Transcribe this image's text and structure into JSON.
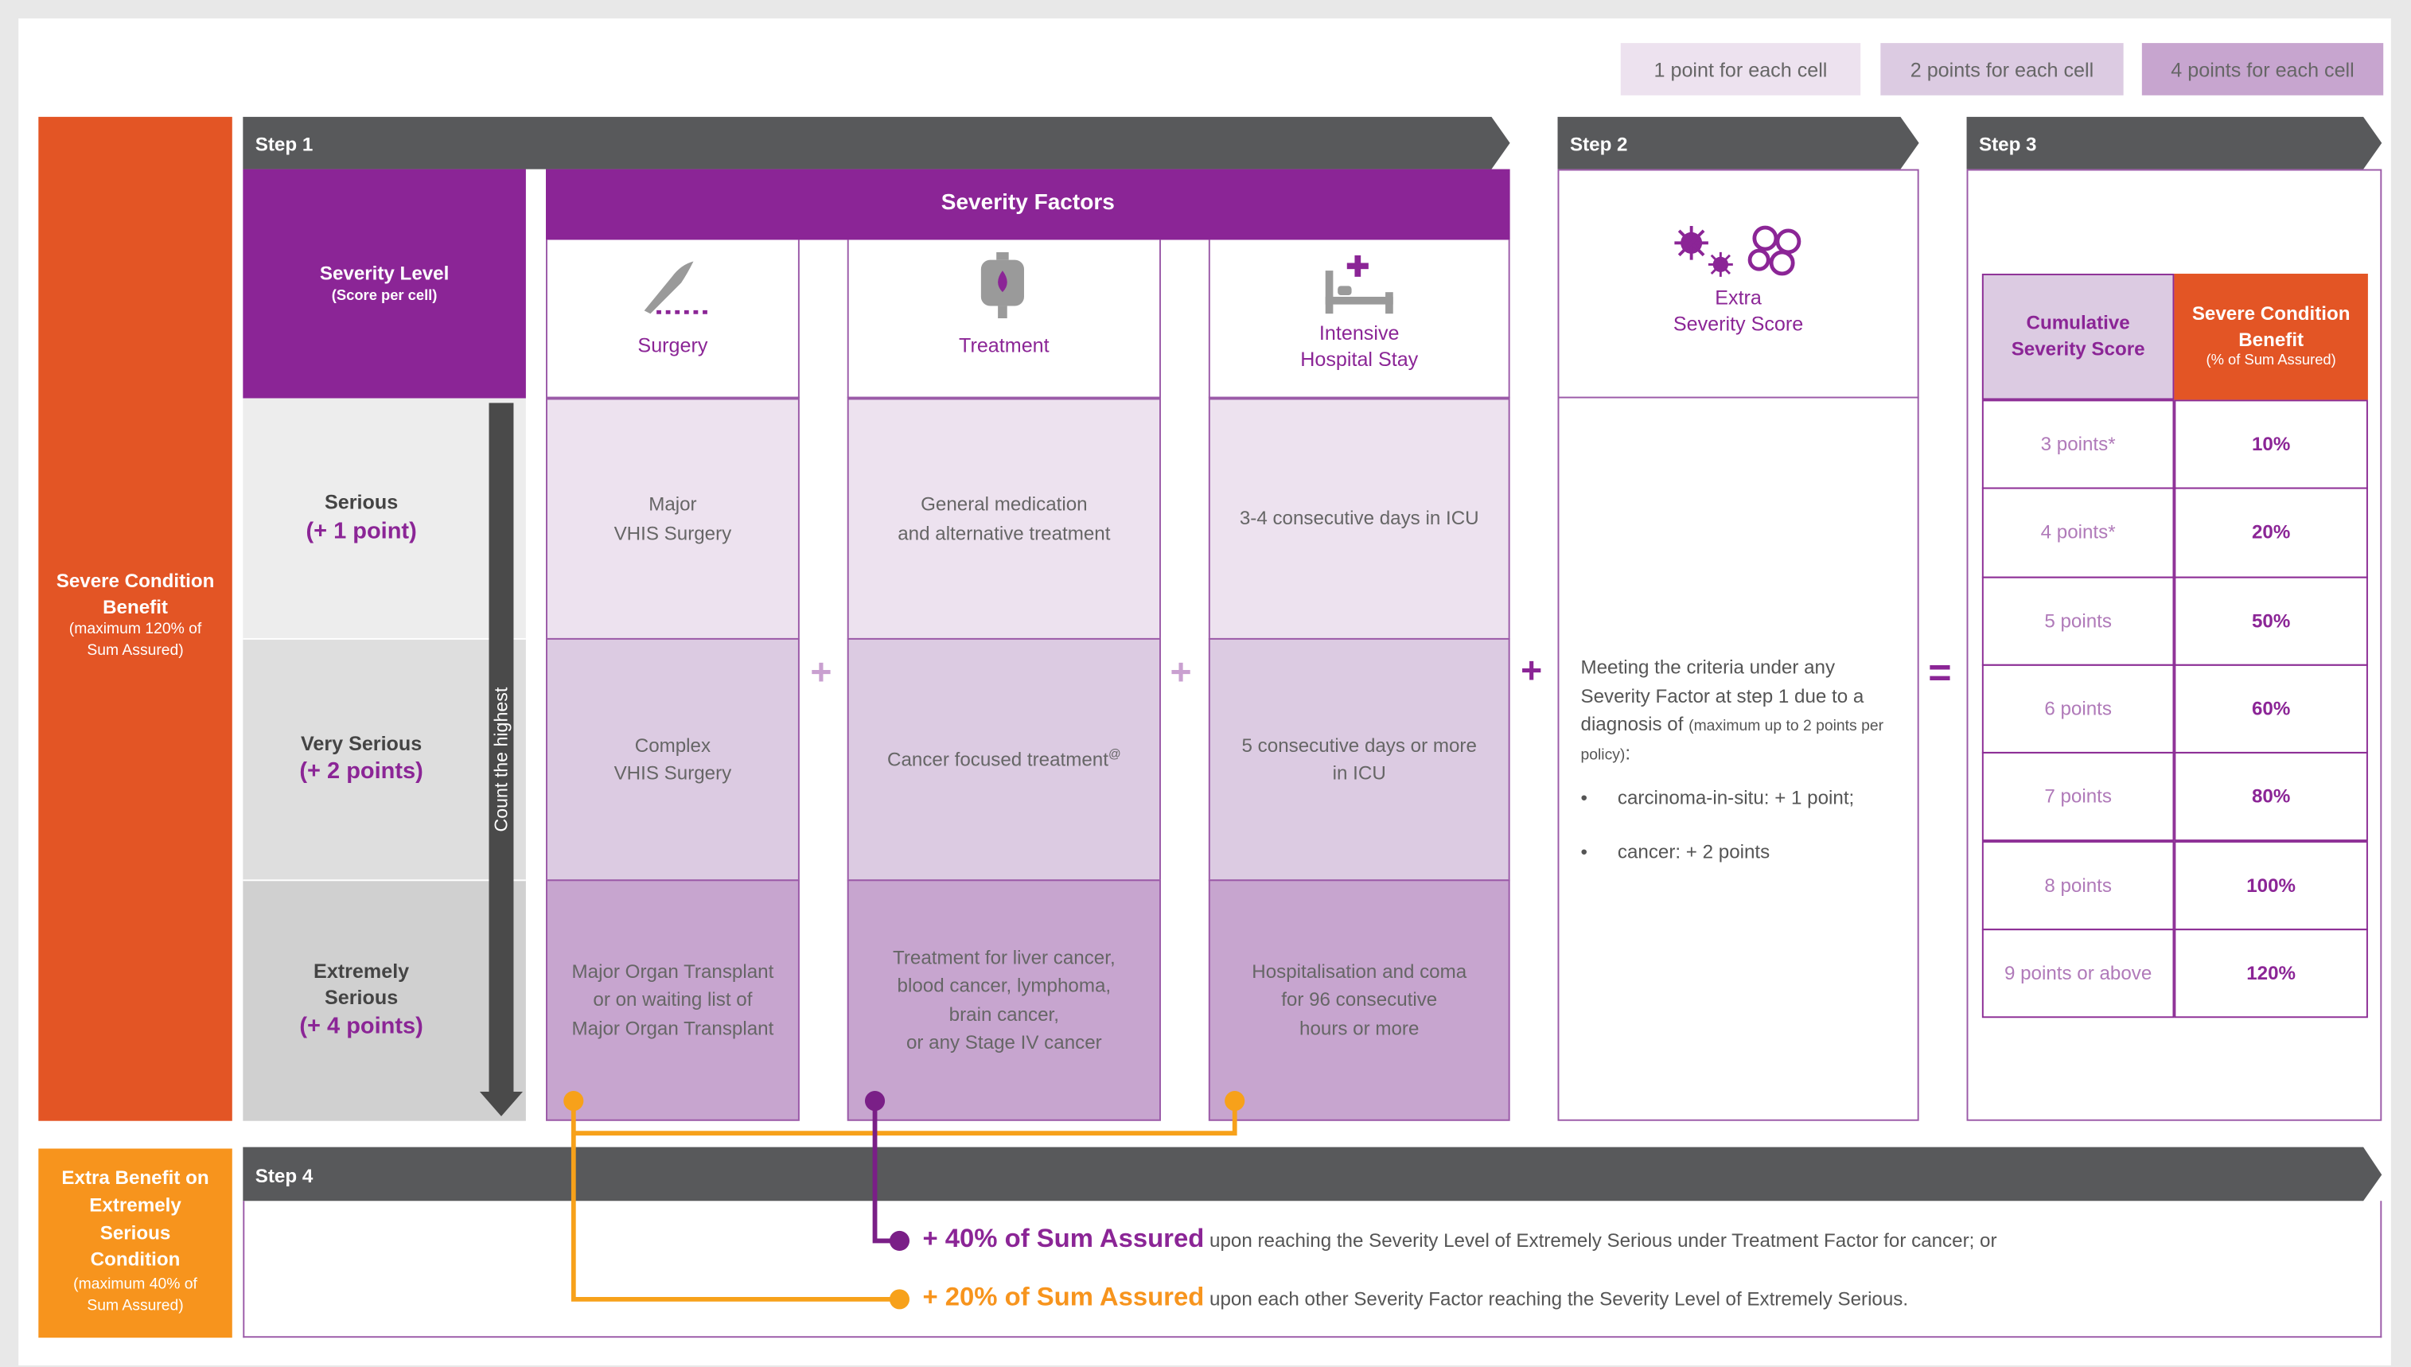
{
  "legend": [
    {
      "label": "1 point for each cell",
      "color": "#ede2ef"
    },
    {
      "label": "2 points for each cell",
      "color": "#dccbe2"
    },
    {
      "label": "4 points for each cell",
      "color": "#c7a5cf"
    }
  ],
  "sidebar": {
    "main_title": "Severe Condition Benefit",
    "main_sub": "(maximum 120% of Sum Assured)",
    "extra_title": "Extra Benefit on Extremely Serious Condition",
    "extra_sub": "(maximum 40% of Sum Assured)"
  },
  "steps": {
    "step1": "Step 1",
    "step2": "Step 2",
    "step3": "Step 3",
    "step4": "Step 4"
  },
  "severity_level": {
    "title": "Severity Level",
    "sub": "(Score per cell)"
  },
  "severity_factors_title": "Severity Factors",
  "factors": {
    "surgery": "Surgery",
    "treatment": "Treatment",
    "icu_line1": "Intensive",
    "icu_line2": "Hospital Stay"
  },
  "levels": [
    {
      "name": "Serious",
      "points": "(+ 1 point)"
    },
    {
      "name": "Very Serious",
      "points": "(+ 2 points)"
    },
    {
      "name1": "Extremely",
      "name2": "Serious",
      "points": "(+ 4 points)"
    }
  ],
  "count_highest": "Count the highest",
  "surgery_cells": [
    {
      "l1": "Major",
      "l2": "VHIS Surgery"
    },
    {
      "l1": "Complex",
      "l2": "VHIS Surgery"
    },
    {
      "l1": "Major Organ Transplant",
      "l2": "or on waiting list of",
      "l3": "Major Organ Transplant"
    }
  ],
  "treatment_cells": [
    {
      "l1": "General medication",
      "l2": "and alternative treatment"
    },
    {
      "l1": "Cancer focused treatment",
      "sup": "@"
    },
    {
      "l1": "Treatment for liver cancer,",
      "l2": "blood cancer, lymphoma,",
      "l3": "brain cancer,",
      "l4": "or any Stage IV cancer"
    }
  ],
  "icu_cells": [
    {
      "l1": "3-4 consecutive days in ICU"
    },
    {
      "l1": "5 consecutive days or more",
      "l2": "in ICU"
    },
    {
      "l1": "Hospitalisation and coma",
      "l2": "for 96 consecutive",
      "l3": "hours or more"
    }
  ],
  "extra_score": {
    "title1": "Extra",
    "title2": "Severity Score",
    "desc1": "Meeting the criteria under any Severity Factor at step 1 due to a diagnosis of ",
    "desc_small": "(maximum up to 2 points per policy)",
    "desc_colon": ":",
    "bullet1": "carcinoma-in-situ: + 1 point;",
    "bullet2": "cancer: + 2 points"
  },
  "symbols": {
    "plus": "+",
    "equals": "=",
    "bullet": "•"
  },
  "score_table": {
    "col1": "Cumulative Severity Score",
    "col2": "Severe Condition Benefit",
    "col2_sub": "(% of Sum Assured)",
    "rows": [
      {
        "score": "3 points*",
        "benefit": "10%"
      },
      {
        "score": "4 points*",
        "benefit": "20%"
      },
      {
        "score": "5 points",
        "benefit": "50%"
      },
      {
        "score": "6 points",
        "benefit": "60%"
      },
      {
        "score": "7 points",
        "benefit": "80%"
      },
      {
        "score": "8 points",
        "benefit": "100%"
      },
      {
        "score": "9 points or above",
        "benefit": "120%"
      }
    ]
  },
  "step4": {
    "line1_bold": "+ 40% of Sum Assured",
    "line1_rest": " upon reaching the Severity Level of Extremely Serious under Treatment Factor for cancer; or",
    "line2_bold": "+ 20% of Sum Assured",
    "line2_rest": " upon each other Severity Factor reaching the Severity Level of Extremely Serious."
  },
  "colors": {
    "orange_red": "#e35525",
    "orange": "#f7941d",
    "purple": "#8b2596",
    "dark_bar": "#58595b",
    "line_purple": "#7a1f87",
    "line_orange": "#f7a11a"
  }
}
